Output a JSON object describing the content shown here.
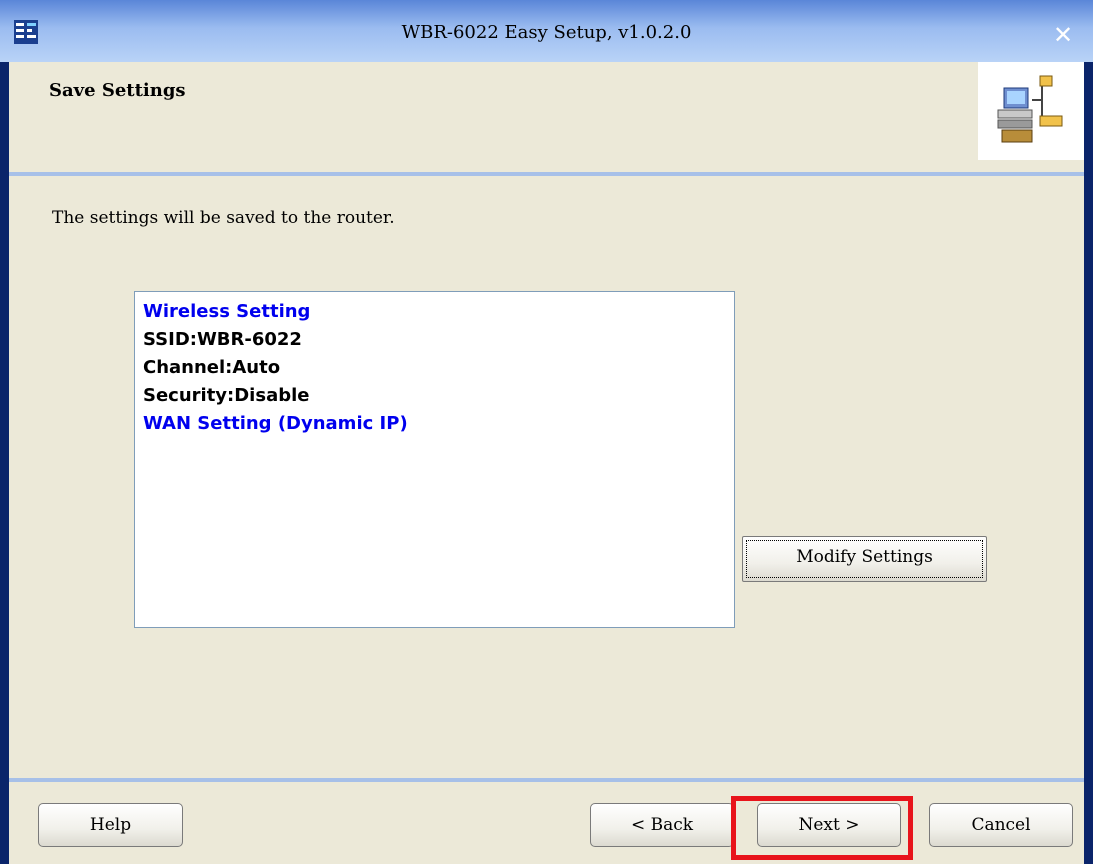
{
  "window": {
    "title": "WBR-6022 Easy Setup, v1.0.2.0",
    "close_label": "✕"
  },
  "header": {
    "title": "Save Settings"
  },
  "content": {
    "intro": "The settings will be saved to the router.",
    "summary": {
      "wireless_heading": "Wireless Setting",
      "ssid": "SSID:WBR-6022",
      "channel": "Channel:Auto",
      "security": "Security:Disable",
      "wan_heading": "WAN Setting  (Dynamic IP)"
    },
    "modify_label": "Modify Settings"
  },
  "footer": {
    "help_label": "Help",
    "back_label": "< Back",
    "next_label": "Next >",
    "cancel_label": "Cancel"
  },
  "icons": {
    "app": "app-icon",
    "header": "network-computers-icon",
    "close": "close-icon"
  },
  "colors": {
    "title_bar": "#5a86d8",
    "panel": "#ece9d8",
    "heading_text": "#0000ee",
    "highlight": "#e8141b"
  }
}
